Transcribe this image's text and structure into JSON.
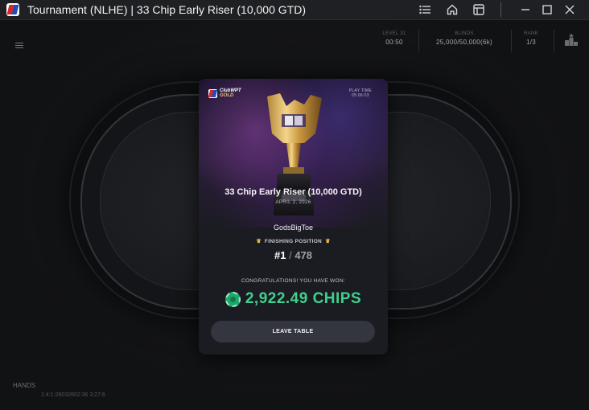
{
  "window": {
    "title": "Tournament (NLHE) | 33 Chip Early Riser (10,000 GTD)"
  },
  "hud": {
    "level_label": "LEVEL 31",
    "level_time": "00:50",
    "blinds_label": "BLINDS",
    "blinds_value": "25,000/50,000(6k)",
    "rank_label": "RANK",
    "rank_value": "1/3"
  },
  "table": {
    "hands_label": "HANDS",
    "hand_id": "1:4:1:26032602:36 3:27:6"
  },
  "card": {
    "brand_name": "ClubWPT",
    "brand_tier": "GOLD",
    "playtime_label": "PLAY TIME",
    "playtime_value": "05:06:03",
    "tournament_name": "33 Chip Early Riser (10,000 GTD)",
    "date": "APRIL 2, 2026",
    "player_name": "GodsBigToe",
    "finishing_label": "FINISHING POSITION",
    "position": "#1",
    "separator": "/",
    "total_players": "478",
    "congrats_text": "CONGRATULATIONS! YOU HAVE WON:",
    "winnings": "2,922.49 CHIPS",
    "leave_button": "LEAVE TABLE"
  },
  "colors": {
    "accent_green": "#3fd08d",
    "crown_gold": "#e8b84a",
    "brand_red": "#d9262c",
    "brand_blue": "#1d4fb8"
  }
}
